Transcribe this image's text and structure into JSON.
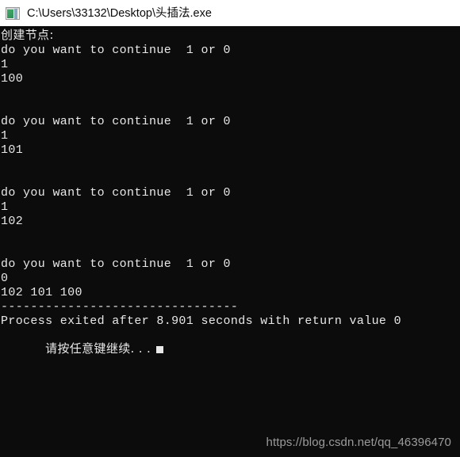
{
  "window": {
    "titlebar": {
      "icon": "console-app-icon",
      "title": "C:\\Users\\33132\\Desktop\\头插法.exe",
      "background_color": "#ffffff",
      "text_color": "#0b0b0b"
    },
    "console": {
      "background_color": "#0c0c0c",
      "text_color": "#e8e8e8",
      "font_size_px": 15,
      "line_height_px": 18,
      "lines": [
        "创建节点:",
        "do you want to continue  1 or 0",
        "1",
        "100",
        "",
        "",
        "do you want to continue  1 or 0",
        "1",
        "101",
        "",
        "",
        "do you want to continue  1 or 0",
        "1",
        "102",
        "",
        "",
        "do you want to continue  1 or 0",
        "0",
        "102 101 100",
        "--------------------------------",
        "Process exited after 8.901 seconds with return value 0"
      ],
      "prompt_line": "请按任意键继续. . .",
      "cursor": {
        "visible": true,
        "color": "#e8e8e8",
        "shape": "block"
      }
    },
    "watermark": {
      "text": "https://blog.csdn.net/qq_46396470",
      "color": "#9b9b9b"
    }
  }
}
